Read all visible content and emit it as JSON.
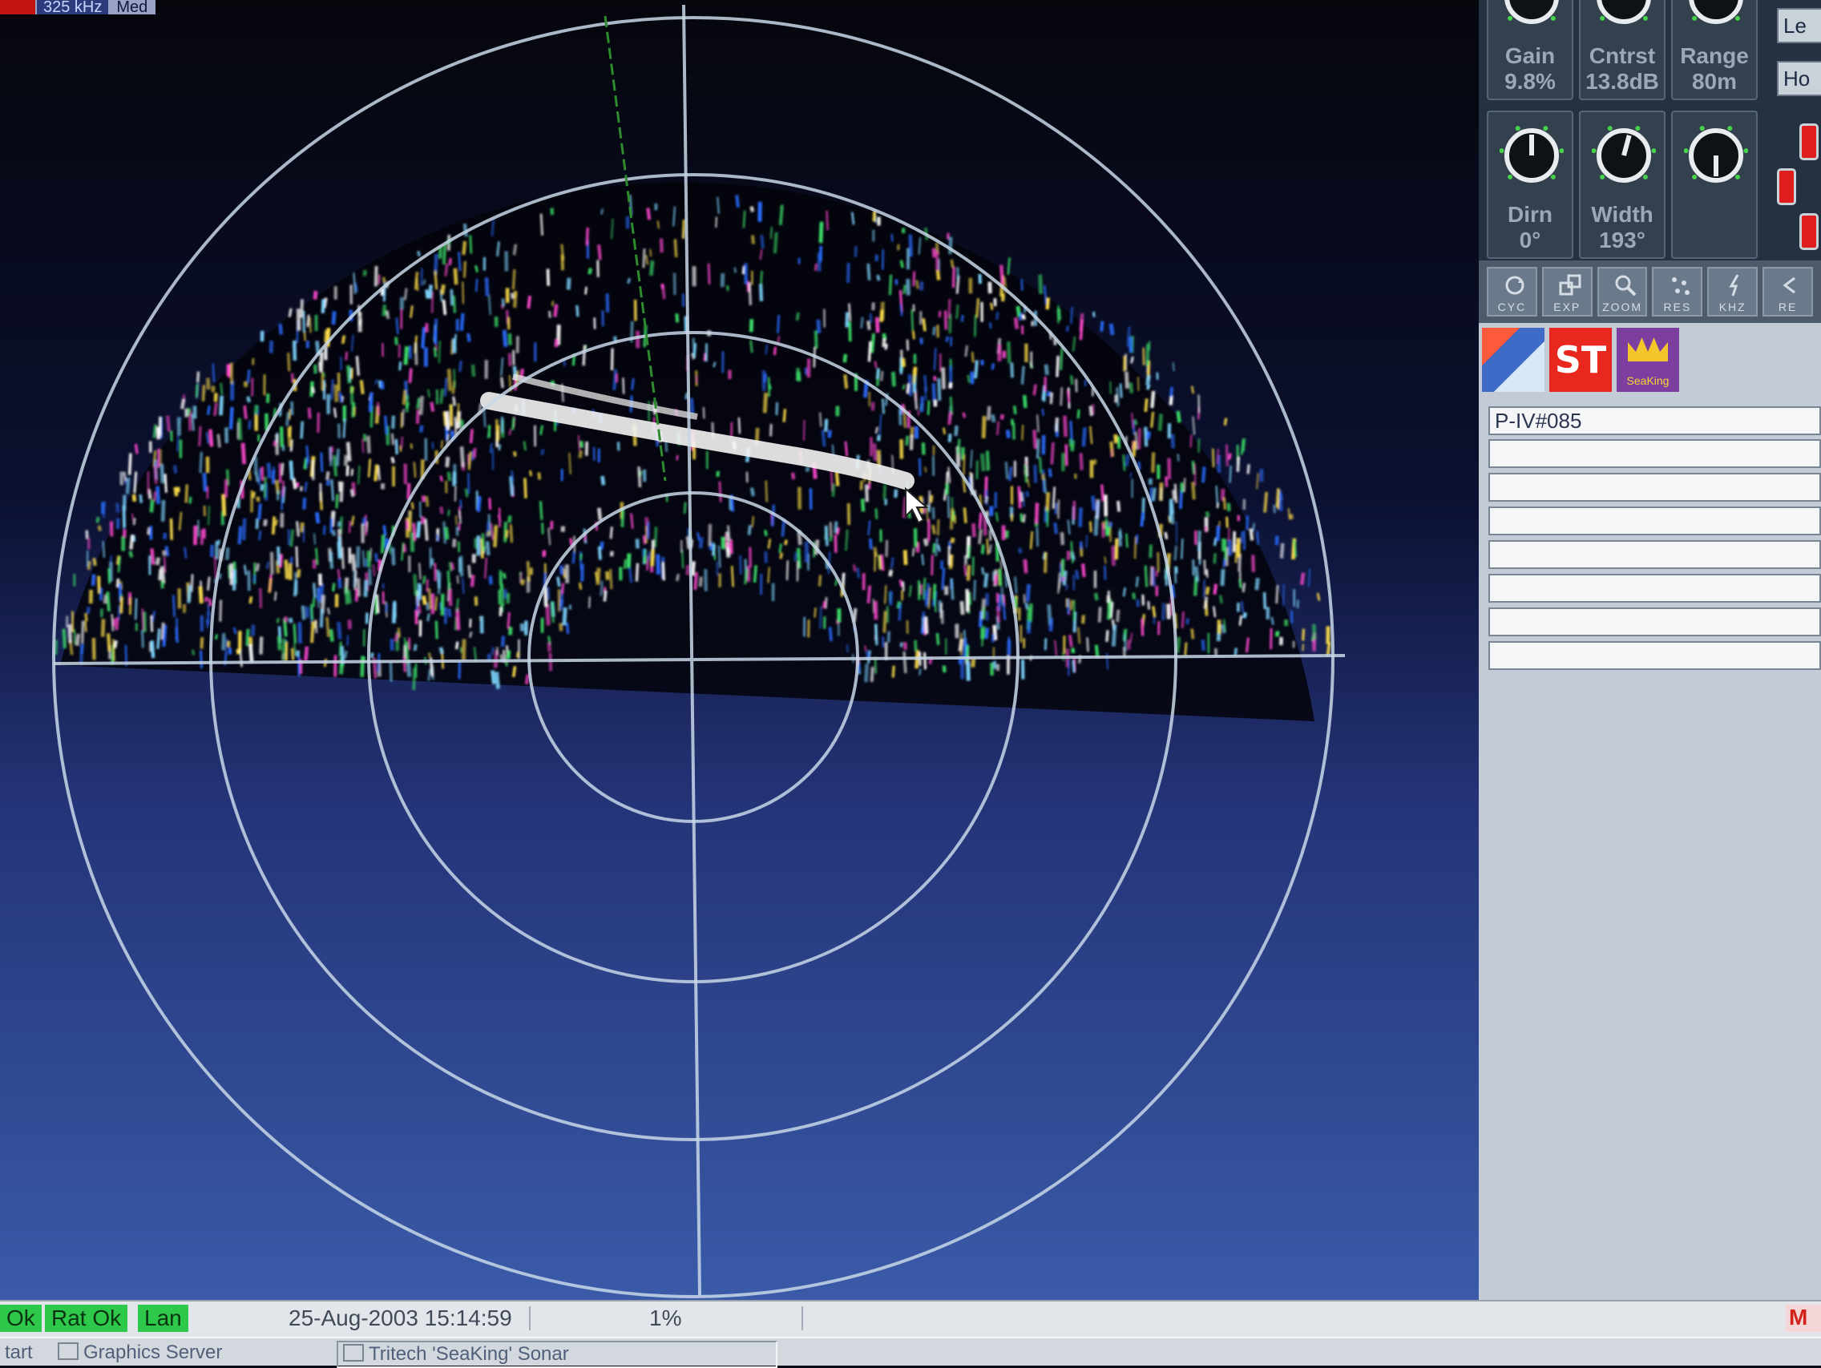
{
  "top_strip": {
    "frequency": "325 kHz",
    "mode": "Med"
  },
  "controls": {
    "knobs": [
      {
        "label": "Gain",
        "value": "9.8%"
      },
      {
        "label": "Cntrst",
        "value": "13.8dB"
      },
      {
        "label": "Range",
        "value": "80m"
      },
      {
        "label": "Dirn",
        "value": "0°"
      },
      {
        "label": "Width",
        "value": "193°"
      },
      {
        "label": "",
        "value": ""
      }
    ],
    "side_buttons": [
      "Le",
      "Ho"
    ]
  },
  "toolbar": {
    "tools": [
      {
        "icon": "cycle-icon",
        "label": "CYC"
      },
      {
        "icon": "expand-icon",
        "label": "EXP"
      },
      {
        "icon": "zoom-icon",
        "label": "ZOOM"
      },
      {
        "icon": "res-icon",
        "label": "RES"
      },
      {
        "icon": "khz-icon",
        "label": "KHZ"
      },
      {
        "icon": "re-icon",
        "label": "RE"
      }
    ]
  },
  "logos": {
    "seaking_text": "SeaKing",
    "st_text": "ST"
  },
  "ident": {
    "label": "P-IV#085",
    "empty_lines": 7
  },
  "status_bar": {
    "ok_left": "Ok",
    "rat_ok": "Rat Ok",
    "lan": "Lan",
    "datetime": "25-Aug-2003 15:14:59",
    "percent": "1%",
    "right_label": "M"
  },
  "taskbar": {
    "start": "tart",
    "items": [
      "Graphics Server",
      "Tritech 'SeaKing' Sonar"
    ]
  },
  "colors": {
    "range_rings": "#c8d8e8",
    "heading_marker": "#2e8b2e",
    "bright_echo": "#ffffff",
    "echo_palette": [
      "#ffe04a",
      "#3ee06a",
      "#2b6dff",
      "#ff4ad0",
      "#7fd6ff"
    ]
  }
}
